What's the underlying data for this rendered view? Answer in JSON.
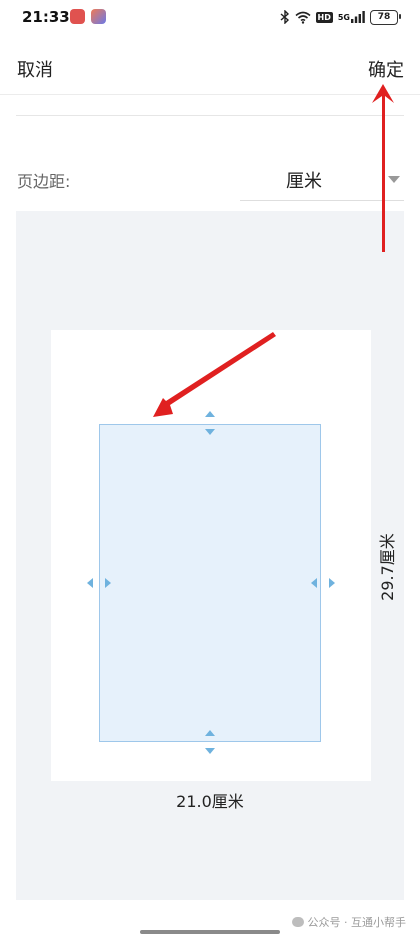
{
  "status_bar": {
    "time": "21:33",
    "signal_label": "5G",
    "hd_label": "HD",
    "battery_level": "78"
  },
  "top_bar": {
    "cancel_label": "取消",
    "confirm_label": "确定"
  },
  "margin": {
    "label": "页边距:",
    "unit_value": "厘米"
  },
  "page_preview": {
    "width_label": "21.0厘米",
    "height_label": "29.7厘米"
  },
  "watermark": {
    "text": "公众号 · 互通小帮手"
  },
  "colors": {
    "accent_arrow": "#e02020",
    "content_fill": "#e6f1fb",
    "content_border": "#9ec7ea",
    "handle": "#6fb2de",
    "preview_bg": "#f1f3f6"
  },
  "icons": [
    "bluetooth-icon",
    "wifi-icon",
    "hd-icon",
    "signal-icon",
    "battery-icon",
    "dropdown-arrow-icon"
  ]
}
